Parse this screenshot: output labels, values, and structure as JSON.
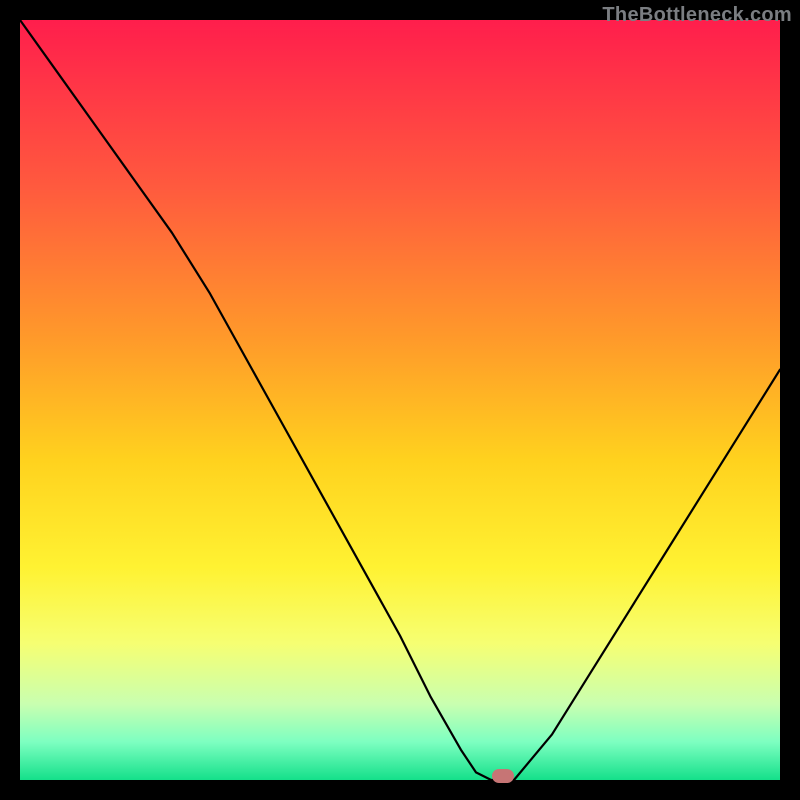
{
  "watermark": "TheBottleneck.com",
  "chart_data": {
    "type": "line",
    "title": "",
    "xlabel": "",
    "ylabel": "",
    "xlim": [
      0,
      100
    ],
    "ylim": [
      0,
      100
    ],
    "grid": false,
    "curve": {
      "name": "bottleneck",
      "x": [
        0,
        5,
        10,
        15,
        20,
        25,
        30,
        35,
        40,
        45,
        50,
        54,
        58,
        60,
        62,
        65,
        70,
        75,
        80,
        85,
        90,
        95,
        100
      ],
      "y": [
        100,
        93,
        86,
        79,
        72,
        64,
        55,
        46,
        37,
        28,
        19,
        11,
        4,
        1,
        0,
        0,
        6,
        14,
        22,
        30,
        38,
        46,
        54
      ]
    },
    "marker": {
      "x": 63.5,
      "y": 0.5,
      "color": "#c67575"
    },
    "gradient_stops": [
      {
        "offset": 0.0,
        "color": "#ff1e4c"
      },
      {
        "offset": 0.22,
        "color": "#ff5a3e"
      },
      {
        "offset": 0.42,
        "color": "#ff9a2a"
      },
      {
        "offset": 0.58,
        "color": "#ffd21e"
      },
      {
        "offset": 0.72,
        "color": "#fff232"
      },
      {
        "offset": 0.82,
        "color": "#f6ff72"
      },
      {
        "offset": 0.9,
        "color": "#c9ffb0"
      },
      {
        "offset": 0.95,
        "color": "#7dffc1"
      },
      {
        "offset": 1.0,
        "color": "#14e08a"
      }
    ]
  },
  "colors": {
    "frame": "#000000",
    "stroke": "#000000"
  }
}
